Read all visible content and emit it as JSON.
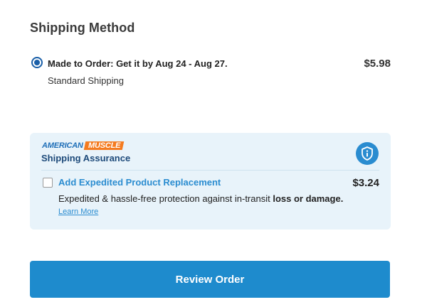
{
  "shipping": {
    "title": "Shipping Method",
    "option": {
      "label": "Made to Order: Get it by Aug 24 - Aug 27.",
      "sub": "Standard Shipping",
      "price": "$5.98",
      "selected": true
    }
  },
  "assurance": {
    "brand_part1": "AMERICAN",
    "brand_part2": "MUSCLE",
    "title": "Shipping Assurance",
    "info_icon": "shield-info-icon",
    "expedite": {
      "label": "Add Expedited Product Replacement",
      "price": "$3.24",
      "desc_prefix": "Expedited & hassle-free protection against in-transit ",
      "desc_bold": "loss or damage.",
      "learn_more": "Learn More",
      "checked": false
    }
  },
  "review_button": "Review Order",
  "colors": {
    "accent": "#1e8bcd",
    "panel": "#e8f3fa",
    "brand_orange": "#f47b20",
    "radio": "#1a5fa8"
  }
}
